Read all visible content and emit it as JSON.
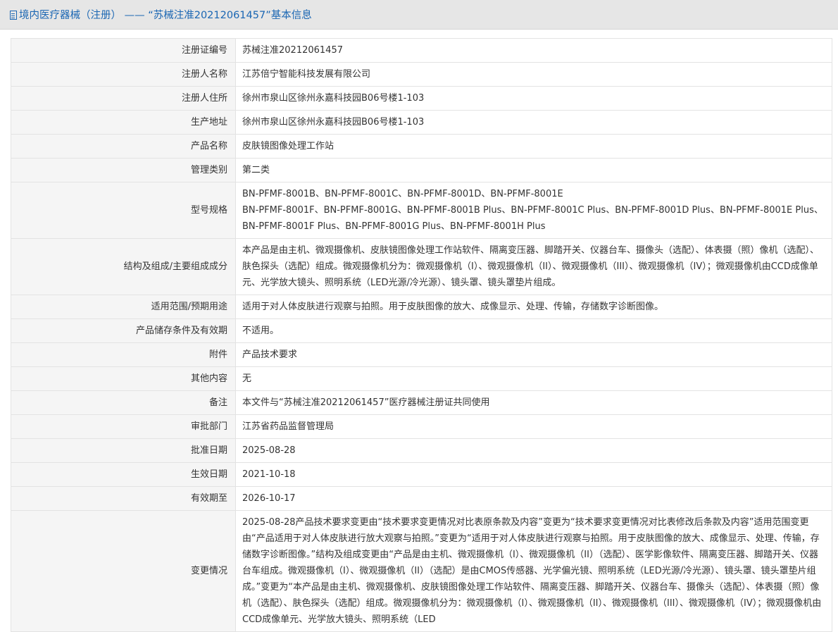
{
  "header": {
    "title": "境内医疗器械（注册） —— “苏械注准20212061457”基本信息"
  },
  "rows": [
    {
      "label": "注册证编号",
      "value": "苏械注准20212061457"
    },
    {
      "label": "注册人名称",
      "value": "江苏倍宁智能科技发展有限公司"
    },
    {
      "label": "注册人住所",
      "value": "徐州市泉山区徐州永嘉科技园B06号楼1-103"
    },
    {
      "label": "生产地址",
      "value": "徐州市泉山区徐州永嘉科技园B06号楼1-103"
    },
    {
      "label": "产品名称",
      "value": "皮肤镜图像处理工作站"
    },
    {
      "label": "管理类别",
      "value": "第二类"
    },
    {
      "label": "型号规格",
      "value_line1": "BN-PFMF-8001B、BN-PFMF-8001C、BN-PFMF-8001D、BN-PFMF-8001E",
      "value_line2": "BN-PFMF-8001F、BN-PFMF-8001G、BN-PFMF-8001B Plus、BN-PFMF-8001C Plus、BN-PFMF-8001D Plus、BN-PFMF-8001E Plus、BN-PFMF-8001F Plus、BN-PFMF-8001G Plus、BN-PFMF-8001H Plus"
    },
    {
      "label": "结构及组成/主要组成成分",
      "value": "本产品是由主机、微观摄像机、皮肤镜图像处理工作站软件、隔离变压器、脚踏开关、仪器台车、摄像头（选配）、体表摄（照）像机（选配）、肤色探头（选配）组成。微观摄像机分为：微观摄像机（I）、微观摄像机（II）、微观摄像机（III）、微观摄像机（IV）；微观摄像机由CCD成像单元、光学放大镜头、照明系统（LED光源/冷光源）、镜头罩、镜头罩垫片组成。"
    },
    {
      "label": "适用范围/预期用途",
      "value": "适用于对人体皮肤进行观察与拍照。用于皮肤图像的放大、成像显示、处理、传输，存储数字诊断图像。"
    },
    {
      "label": "产品储存条件及有效期",
      "value": "不适用。"
    },
    {
      "label": "附件",
      "value": "产品技术要求"
    },
    {
      "label": "其他内容",
      "value": "无"
    },
    {
      "label": "备注",
      "value": "本文件与“苏械注准20212061457”医疗器械注册证共同使用"
    },
    {
      "label": "审批部门",
      "value": "江苏省药品监督管理局"
    },
    {
      "label": "批准日期",
      "value": "2025-08-28"
    },
    {
      "label": "生效日期",
      "value": "2021-10-18"
    },
    {
      "label": "有效期至",
      "value": "2026-10-17"
    },
    {
      "label": "变更情况",
      "value": "2025-08-28产品技术要求变更由“技术要求变更情况对比表原条款及内容”变更为“技术要求变更情况对比表修改后条款及内容”适用范围变更由“产品适用于对人体皮肤进行放大观察与拍照。”变更为“适用于对人体皮肤进行观察与拍照。用于皮肤图像的放大、成像显示、处理、传输，存储数字诊断图像。”结构及组成变更由“产品是由主机、微观摄像机（I）、微观摄像机（II）（选配）、医学影像软件、隔离变压器、脚踏开关、仪器台车组成。微观摄像机（I）、微观摄像机（II）（选配）是由CMOS传感器、光学偏光镜、照明系统（LED光源/冷光源）、镜头罩、镜头罩垫片组成。”变更为“本产品是由主机、微观摄像机、皮肤镜图像处理工作站软件、隔离变压器、脚踏开关、仪器台车、摄像头（选配）、体表摄（照）像机（选配）、肤色探头（选配）组成。微观摄像机分为：微观摄像机（I）、微观摄像机（II）、微观摄像机（III）、微观摄像机（IV）；微观摄像机由CCD成像单元、光学放大镜头、照明系统（LED"
    }
  ]
}
